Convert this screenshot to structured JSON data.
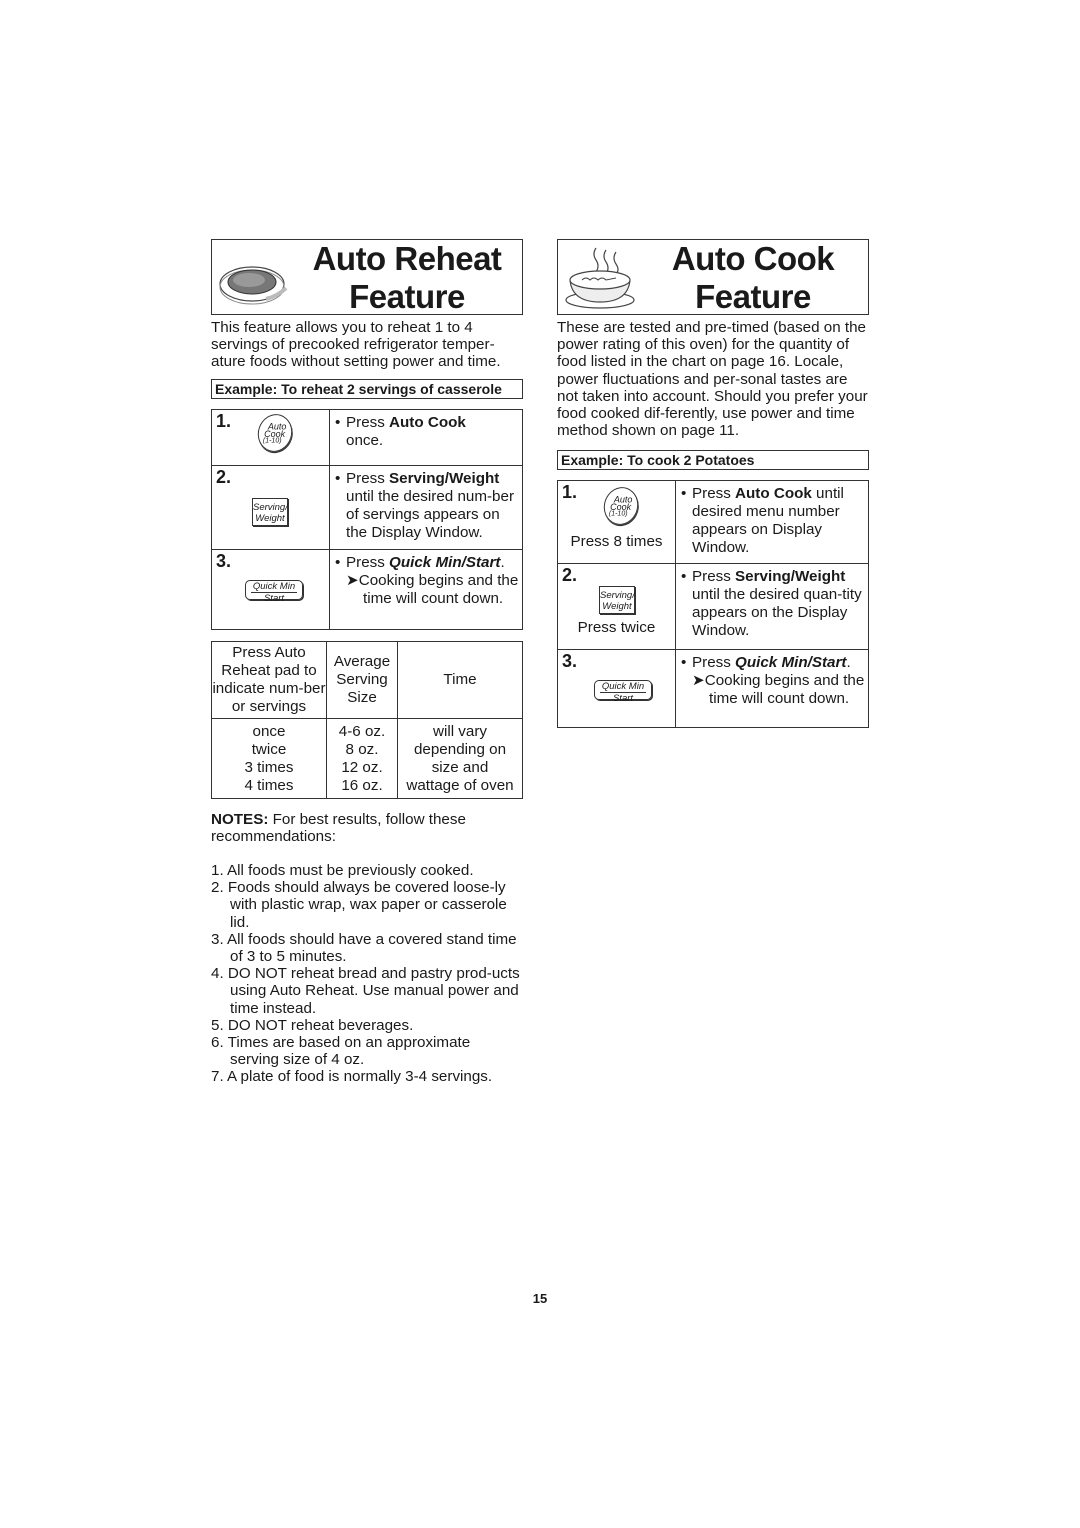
{
  "page_number": "15",
  "auto_reheat": {
    "title_line1": "Auto Reheat",
    "title_line2": "Feature",
    "illustration": "plate-of-food-icon",
    "intro": "This feature allows you to reheat 1 to 4 servings of precooked refrigerator temper-ature foods without setting power and time.",
    "example": "Example: To reheat 2 servings of casserole",
    "steps": [
      {
        "number": "1.",
        "button_lines": [
          "Auto",
          "Cook",
          "(1-10)"
        ],
        "button_type": "oval",
        "prefix": "Press ",
        "key": "Auto Cook",
        "rest": "once."
      },
      {
        "number": "2.",
        "button_lines": [
          "Serving/",
          "Weight"
        ],
        "button_type": "rect",
        "prefix": "Press ",
        "key": "Serving/Weight",
        "rest": "until the desired num-ber of servings appears on the Display Window."
      },
      {
        "number": "3.",
        "button_lines": [
          "Quick Min",
          "Start"
        ],
        "button_type": "rounded",
        "prefix": "Press ",
        "key": "Quick Min/Start",
        "suffix": ".",
        "arrow_text": "Cooking begins and the time will count down."
      }
    ],
    "servings_table": {
      "headers": [
        "Press Auto Reheat pad to indicate num-ber or servings",
        "Average Serving Size",
        "Time"
      ],
      "presses": [
        "once",
        "twice",
        "3 times",
        "4 times"
      ],
      "sizes": [
        "4-6 oz.",
        "8 oz.",
        "12 oz.",
        "16 oz."
      ],
      "time": [
        "will vary",
        "depending on",
        "size and",
        "wattage of oven"
      ]
    },
    "notes": {
      "label": "NOTES:",
      "intro": " For best results, follow these recommendations:",
      "items": [
        "1. All foods must be previously cooked.",
        "2. Foods should always be covered loose-ly with plastic wrap, wax paper or casserole lid.",
        "3. All foods should have a covered stand time of 3 to 5 minutes.",
        "4. DO NOT reheat bread and pastry prod-ucts using Auto Reheat. Use manual power and time instead.",
        "5. DO NOT reheat beverages.",
        "6. Times are based on an approximate serving size of 4 oz.",
        "7. A plate of food is normally 3-4 servings."
      ]
    }
  },
  "auto_cook": {
    "title_line1": "Auto Cook",
    "title_line2": "Feature",
    "illustration": "steaming-bowl-icon",
    "intro": "These are tested and pre-timed (based on the power rating of this oven) for the quantity of food listed in the chart on page 16. Locale, power fluctuations and per-sonal tastes are not taken into account. Should you prefer your food cooked dif-ferently, use power and time method shown on page 11.",
    "example": "Example:  To cook 2 Potatoes",
    "steps": [
      {
        "number": "1.",
        "button_lines": [
          "Auto",
          "Cook",
          "(1-10)"
        ],
        "press_note": "Press 8 times",
        "prefix": "Press ",
        "key": "Auto Cook",
        "rest": " until desired menu number appears on Display Window."
      },
      {
        "number": "2.",
        "button_lines": [
          "Serving/",
          "Weight"
        ],
        "press_note": "Press twice",
        "prefix": "Press ",
        "key": "Serving/Weight",
        "rest": "until the desired quan-tity appears on the Display Window."
      },
      {
        "number": "3.",
        "button_lines": [
          "Quick Min",
          "Start"
        ],
        "prefix": "Press ",
        "key": "Quick Min/Start",
        "suffix": ".",
        "arrow_text": "Cooking begins and the time will count down."
      }
    ]
  },
  "glyphs": {
    "bullet": "•",
    "arrow": "➤"
  }
}
